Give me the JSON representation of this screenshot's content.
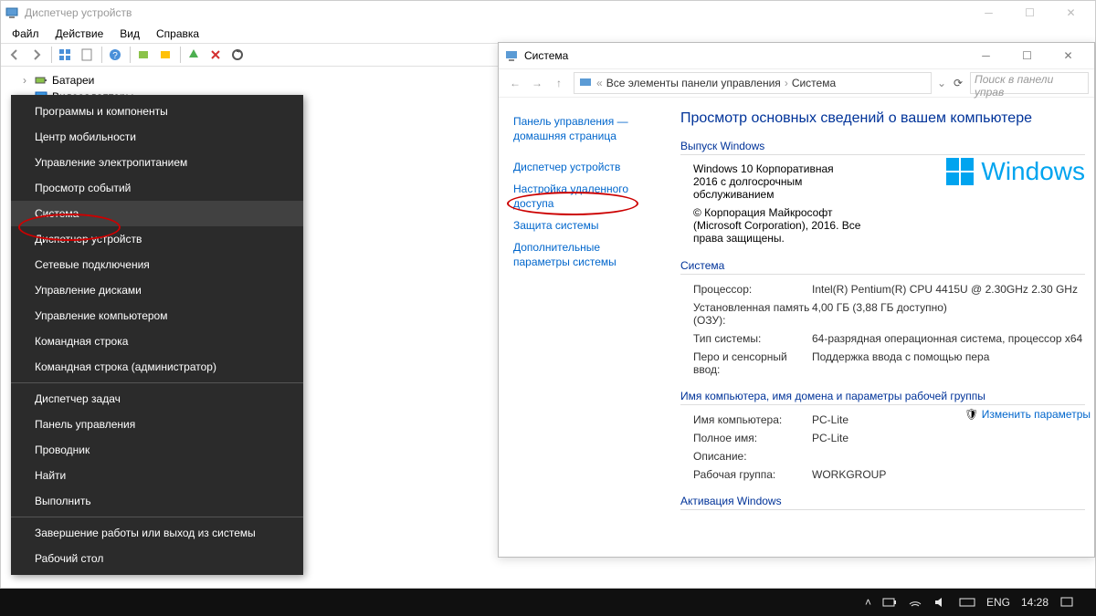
{
  "dm": {
    "title": "Диспетчер устройств",
    "menu": [
      "Файл",
      "Действие",
      "Вид",
      "Справка"
    ],
    "tree": [
      {
        "icon": "battery",
        "label": "Батареи"
      },
      {
        "icon": "display",
        "label": "Видеоадаптеры"
      }
    ]
  },
  "ctx": {
    "items": [
      "Программы и компоненты",
      "Центр мобильности",
      "Управление электропитанием",
      "Просмотр событий",
      "Система",
      "Диспетчер устройств",
      "Сетевые подключения",
      "Управление дисками",
      "Управление компьютером",
      "Командная строка",
      "Командная строка (администратор)",
      "__sep__",
      "Диспетчер задач",
      "Панель управления",
      "Проводник",
      "Найти",
      "Выполнить",
      "__sep__",
      "Завершение работы или выход из системы",
      "Рабочий стол"
    ],
    "highlighted_index": 4
  },
  "sys": {
    "title": "Система",
    "breadcrumb": [
      "Все элементы панели управления",
      "Система"
    ],
    "search_placeholder": "Поиск в панели управ",
    "nav": [
      "Панель управления — домашняя страница",
      "Диспетчер устройств",
      "Настройка удаленного доступа",
      "Защита системы",
      "Дополнительные параметры системы"
    ],
    "heading": "Просмотр основных сведений о вашем компьютере",
    "edition_group": "Выпуск Windows",
    "edition_lines": [
      "Windows 10 Корпоративная 2016 с долгосрочным обслуживанием",
      "© Корпорация Майкрософт (Microsoft Corporation), 2016. Все права защищены."
    ],
    "logo_text": "Windows",
    "system_group": "Система",
    "rows_system": [
      {
        "l": "Процессор:",
        "v": "Intel(R) Pentium(R) CPU 4415U @ 2.30GHz   2.30 GHz"
      },
      {
        "l": "Установленная память (ОЗУ):",
        "v": "4,00 ГБ (3,88 ГБ доступно)"
      },
      {
        "l": "Тип системы:",
        "v": "64-разрядная операционная система, процессор x64"
      },
      {
        "l": "Перо и сенсорный ввод:",
        "v": "Поддержка ввода с помощью пера"
      }
    ],
    "name_group": "Имя компьютера, имя домена и параметры рабочей группы",
    "rows_name": [
      {
        "l": "Имя компьютера:",
        "v": "PC-Lite"
      },
      {
        "l": "Полное имя:",
        "v": "PC-Lite"
      },
      {
        "l": "Описание:",
        "v": ""
      },
      {
        "l": "Рабочая группа:",
        "v": "WORKGROUP"
      }
    ],
    "change_link": "Изменить параметры",
    "activation_group": "Активация Windows"
  },
  "taskbar": {
    "lang": "ENG",
    "time": "14:28"
  }
}
